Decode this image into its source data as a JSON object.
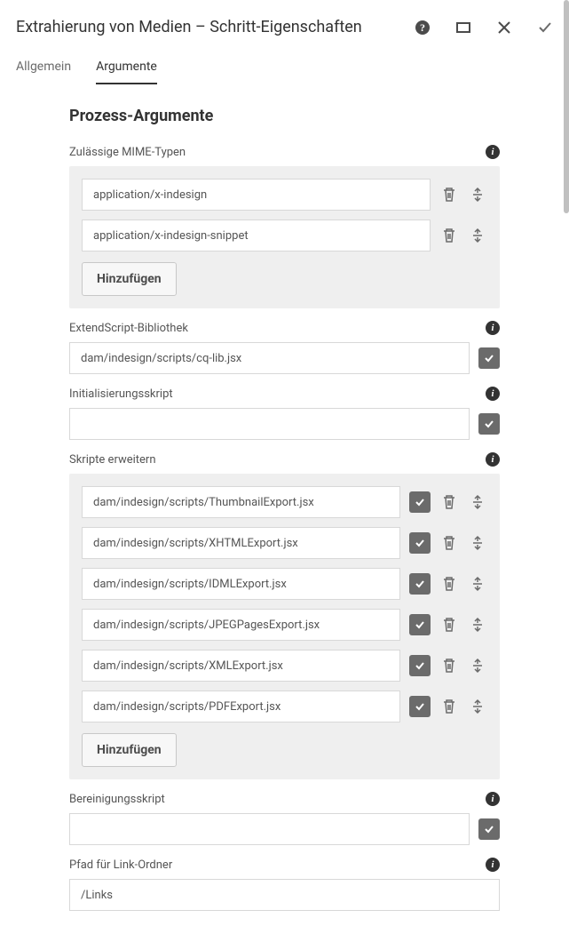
{
  "header": {
    "title": "Extrahierung von Medien – Schritt-Eigenschaften"
  },
  "tabs": {
    "general": "Allgemein",
    "arguments": "Argumente"
  },
  "section_title": "Prozess-Argumente",
  "fields": {
    "mime": {
      "label": "Zulässige MIME-Typen",
      "items": [
        {
          "value": "application/x-indesign"
        },
        {
          "value": "application/x-indesign-snippet"
        }
      ],
      "add_label": "Hinzufügen"
    },
    "extendscript": {
      "label": "ExtendScript-Bibliothek",
      "value": "dam/indesign/scripts/cq-lib.jsx"
    },
    "init": {
      "label": "Initialisierungsskript",
      "value": ""
    },
    "extend_scripts": {
      "label": "Skripte erweitern",
      "items": [
        {
          "value": "dam/indesign/scripts/ThumbnailExport.jsx"
        },
        {
          "value": "dam/indesign/scripts/XHTMLExport.jsx"
        },
        {
          "value": "dam/indesign/scripts/IDMLExport.jsx"
        },
        {
          "value": "dam/indesign/scripts/JPEGPagesExport.jsx"
        },
        {
          "value": "dam/indesign/scripts/XMLExport.jsx"
        },
        {
          "value": "dam/indesign/scripts/PDFExport.jsx"
        }
      ],
      "add_label": "Hinzufügen"
    },
    "cleanup": {
      "label": "Bereinigungsskript",
      "value": ""
    },
    "link_folder": {
      "label": "Pfad für Link-Ordner",
      "value": "/Links"
    }
  }
}
